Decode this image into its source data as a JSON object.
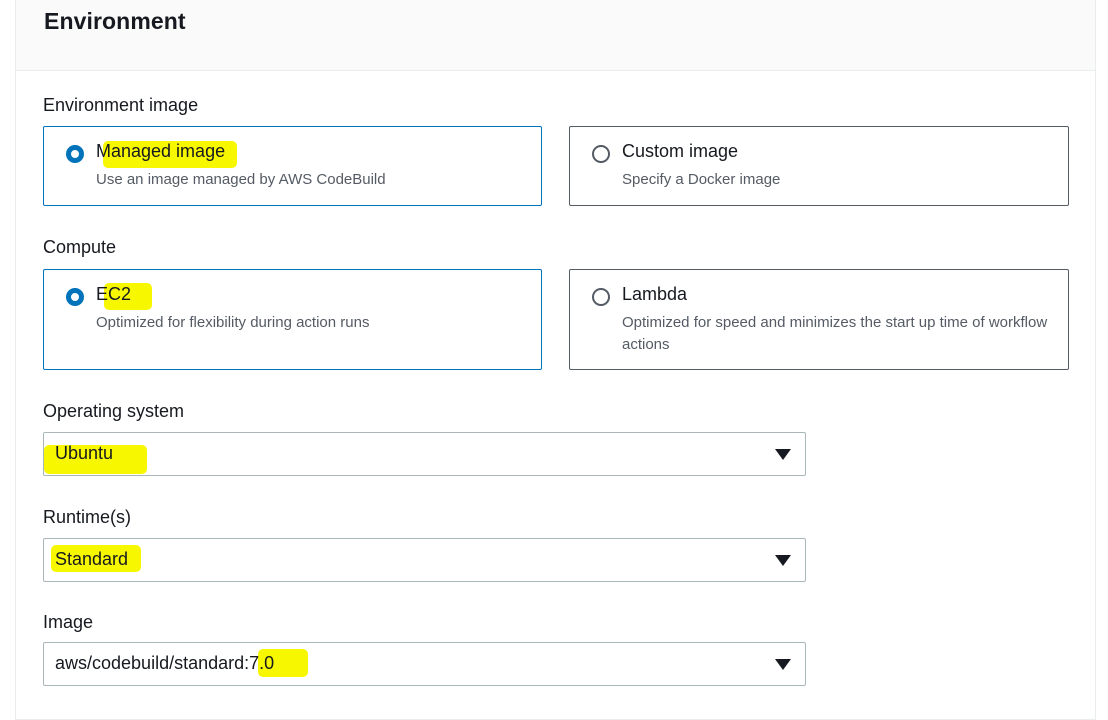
{
  "section": {
    "title": "Environment"
  },
  "environment_image": {
    "label": "Environment image",
    "options": [
      {
        "title": "Managed image",
        "description": "Use an image managed by AWS CodeBuild",
        "selected": true
      },
      {
        "title": "Custom image",
        "description": "Specify a Docker image",
        "selected": false
      }
    ]
  },
  "compute": {
    "label": "Compute",
    "options": [
      {
        "title": "EC2",
        "description": "Optimized for flexibility during action runs",
        "selected": true
      },
      {
        "title": "Lambda",
        "description": "Optimized for speed and minimizes the start up time of workflow actions",
        "selected": false
      }
    ]
  },
  "operating_system": {
    "label": "Operating system",
    "value": "Ubuntu"
  },
  "runtime": {
    "label": "Runtime(s)",
    "value": "Standard"
  },
  "image": {
    "label": "Image",
    "value": "aws/codebuild/standard:7.0"
  },
  "icons": {
    "dropdown": "caret-down-icon",
    "radio": "radio-button-icon"
  },
  "colors": {
    "accent": "#0073bb",
    "selected_tile_bg": "#f1faff",
    "highlight": "#f7f700"
  }
}
